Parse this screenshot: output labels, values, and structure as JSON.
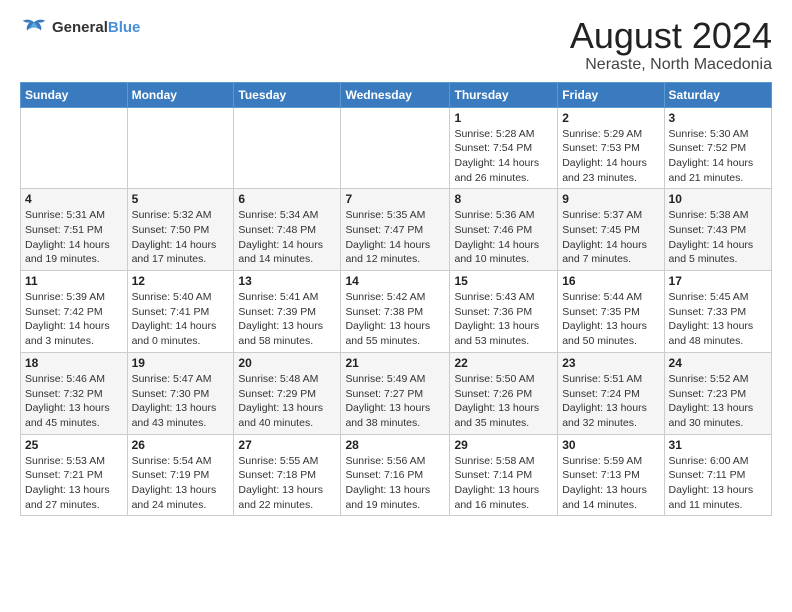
{
  "logo": {
    "line1": "General",
    "line2": "Blue"
  },
  "header": {
    "title": "August 2024",
    "subtitle": "Neraste, North Macedonia"
  },
  "columns": [
    "Sunday",
    "Monday",
    "Tuesday",
    "Wednesday",
    "Thursday",
    "Friday",
    "Saturday"
  ],
  "weeks": [
    [
      {
        "day": "",
        "info": ""
      },
      {
        "day": "",
        "info": ""
      },
      {
        "day": "",
        "info": ""
      },
      {
        "day": "",
        "info": ""
      },
      {
        "day": "1",
        "info": "Sunrise: 5:28 AM\nSunset: 7:54 PM\nDaylight: 14 hours and 26 minutes."
      },
      {
        "day": "2",
        "info": "Sunrise: 5:29 AM\nSunset: 7:53 PM\nDaylight: 14 hours and 23 minutes."
      },
      {
        "day": "3",
        "info": "Sunrise: 5:30 AM\nSunset: 7:52 PM\nDaylight: 14 hours and 21 minutes."
      }
    ],
    [
      {
        "day": "4",
        "info": "Sunrise: 5:31 AM\nSunset: 7:51 PM\nDaylight: 14 hours and 19 minutes."
      },
      {
        "day": "5",
        "info": "Sunrise: 5:32 AM\nSunset: 7:50 PM\nDaylight: 14 hours and 17 minutes."
      },
      {
        "day": "6",
        "info": "Sunrise: 5:34 AM\nSunset: 7:48 PM\nDaylight: 14 hours and 14 minutes."
      },
      {
        "day": "7",
        "info": "Sunrise: 5:35 AM\nSunset: 7:47 PM\nDaylight: 14 hours and 12 minutes."
      },
      {
        "day": "8",
        "info": "Sunrise: 5:36 AM\nSunset: 7:46 PM\nDaylight: 14 hours and 10 minutes."
      },
      {
        "day": "9",
        "info": "Sunrise: 5:37 AM\nSunset: 7:45 PM\nDaylight: 14 hours and 7 minutes."
      },
      {
        "day": "10",
        "info": "Sunrise: 5:38 AM\nSunset: 7:43 PM\nDaylight: 14 hours and 5 minutes."
      }
    ],
    [
      {
        "day": "11",
        "info": "Sunrise: 5:39 AM\nSunset: 7:42 PM\nDaylight: 14 hours and 3 minutes."
      },
      {
        "day": "12",
        "info": "Sunrise: 5:40 AM\nSunset: 7:41 PM\nDaylight: 14 hours and 0 minutes."
      },
      {
        "day": "13",
        "info": "Sunrise: 5:41 AM\nSunset: 7:39 PM\nDaylight: 13 hours and 58 minutes."
      },
      {
        "day": "14",
        "info": "Sunrise: 5:42 AM\nSunset: 7:38 PM\nDaylight: 13 hours and 55 minutes."
      },
      {
        "day": "15",
        "info": "Sunrise: 5:43 AM\nSunset: 7:36 PM\nDaylight: 13 hours and 53 minutes."
      },
      {
        "day": "16",
        "info": "Sunrise: 5:44 AM\nSunset: 7:35 PM\nDaylight: 13 hours and 50 minutes."
      },
      {
        "day": "17",
        "info": "Sunrise: 5:45 AM\nSunset: 7:33 PM\nDaylight: 13 hours and 48 minutes."
      }
    ],
    [
      {
        "day": "18",
        "info": "Sunrise: 5:46 AM\nSunset: 7:32 PM\nDaylight: 13 hours and 45 minutes."
      },
      {
        "day": "19",
        "info": "Sunrise: 5:47 AM\nSunset: 7:30 PM\nDaylight: 13 hours and 43 minutes."
      },
      {
        "day": "20",
        "info": "Sunrise: 5:48 AM\nSunset: 7:29 PM\nDaylight: 13 hours and 40 minutes."
      },
      {
        "day": "21",
        "info": "Sunrise: 5:49 AM\nSunset: 7:27 PM\nDaylight: 13 hours and 38 minutes."
      },
      {
        "day": "22",
        "info": "Sunrise: 5:50 AM\nSunset: 7:26 PM\nDaylight: 13 hours and 35 minutes."
      },
      {
        "day": "23",
        "info": "Sunrise: 5:51 AM\nSunset: 7:24 PM\nDaylight: 13 hours and 32 minutes."
      },
      {
        "day": "24",
        "info": "Sunrise: 5:52 AM\nSunset: 7:23 PM\nDaylight: 13 hours and 30 minutes."
      }
    ],
    [
      {
        "day": "25",
        "info": "Sunrise: 5:53 AM\nSunset: 7:21 PM\nDaylight: 13 hours and 27 minutes."
      },
      {
        "day": "26",
        "info": "Sunrise: 5:54 AM\nSunset: 7:19 PM\nDaylight: 13 hours and 24 minutes."
      },
      {
        "day": "27",
        "info": "Sunrise: 5:55 AM\nSunset: 7:18 PM\nDaylight: 13 hours and 22 minutes."
      },
      {
        "day": "28",
        "info": "Sunrise: 5:56 AM\nSunset: 7:16 PM\nDaylight: 13 hours and 19 minutes."
      },
      {
        "day": "29",
        "info": "Sunrise: 5:58 AM\nSunset: 7:14 PM\nDaylight: 13 hours and 16 minutes."
      },
      {
        "day": "30",
        "info": "Sunrise: 5:59 AM\nSunset: 7:13 PM\nDaylight: 13 hours and 14 minutes."
      },
      {
        "day": "31",
        "info": "Sunrise: 6:00 AM\nSunset: 7:11 PM\nDaylight: 13 hours and 11 minutes."
      }
    ]
  ]
}
